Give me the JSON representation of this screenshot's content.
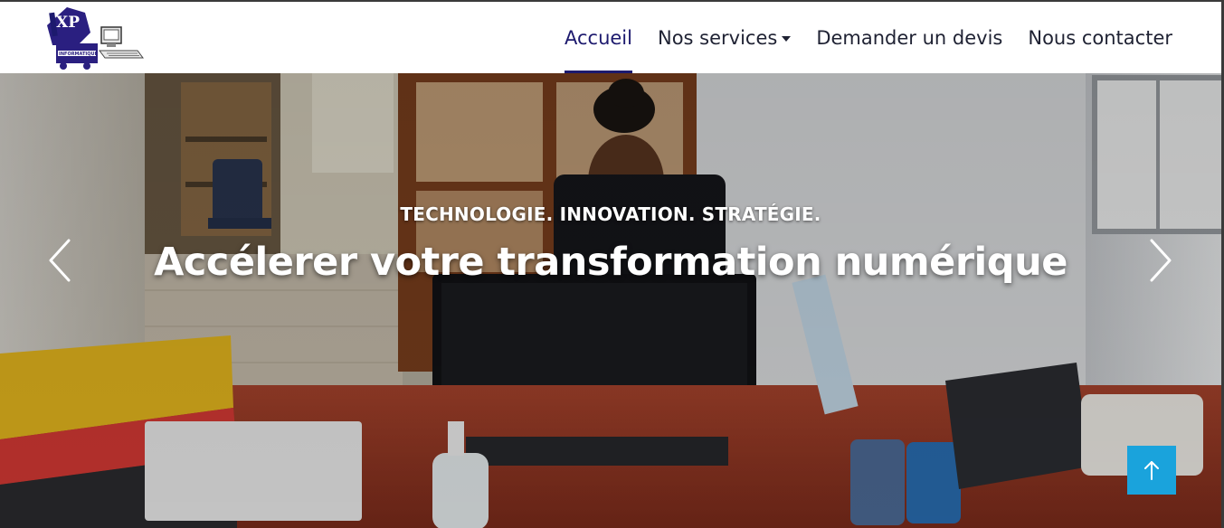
{
  "brand": {
    "logo_alt": "XP Informatique",
    "logo_letters": "XP",
    "logo_subtext": "INFORMATIQUE"
  },
  "nav": {
    "items": [
      {
        "label": "Accueil",
        "active": true
      },
      {
        "label": "Nos services",
        "dropdown": true
      },
      {
        "label": "Demander un devis"
      },
      {
        "label": "Nous contacter"
      }
    ]
  },
  "hero": {
    "tagline": "TECHNOLOGIE. INNOVATION. STRATÉGIE.",
    "headline": "Accélerer votre transformation numérique",
    "prev_icon": "chevron-left-icon",
    "next_icon": "chevron-right-icon"
  },
  "back_to_top": {
    "icon": "arrow-up-icon"
  },
  "colors": {
    "brand_navy": "#1d1a6e",
    "accent_blue": "#1aa3dc",
    "nav_text": "#1f2233"
  }
}
